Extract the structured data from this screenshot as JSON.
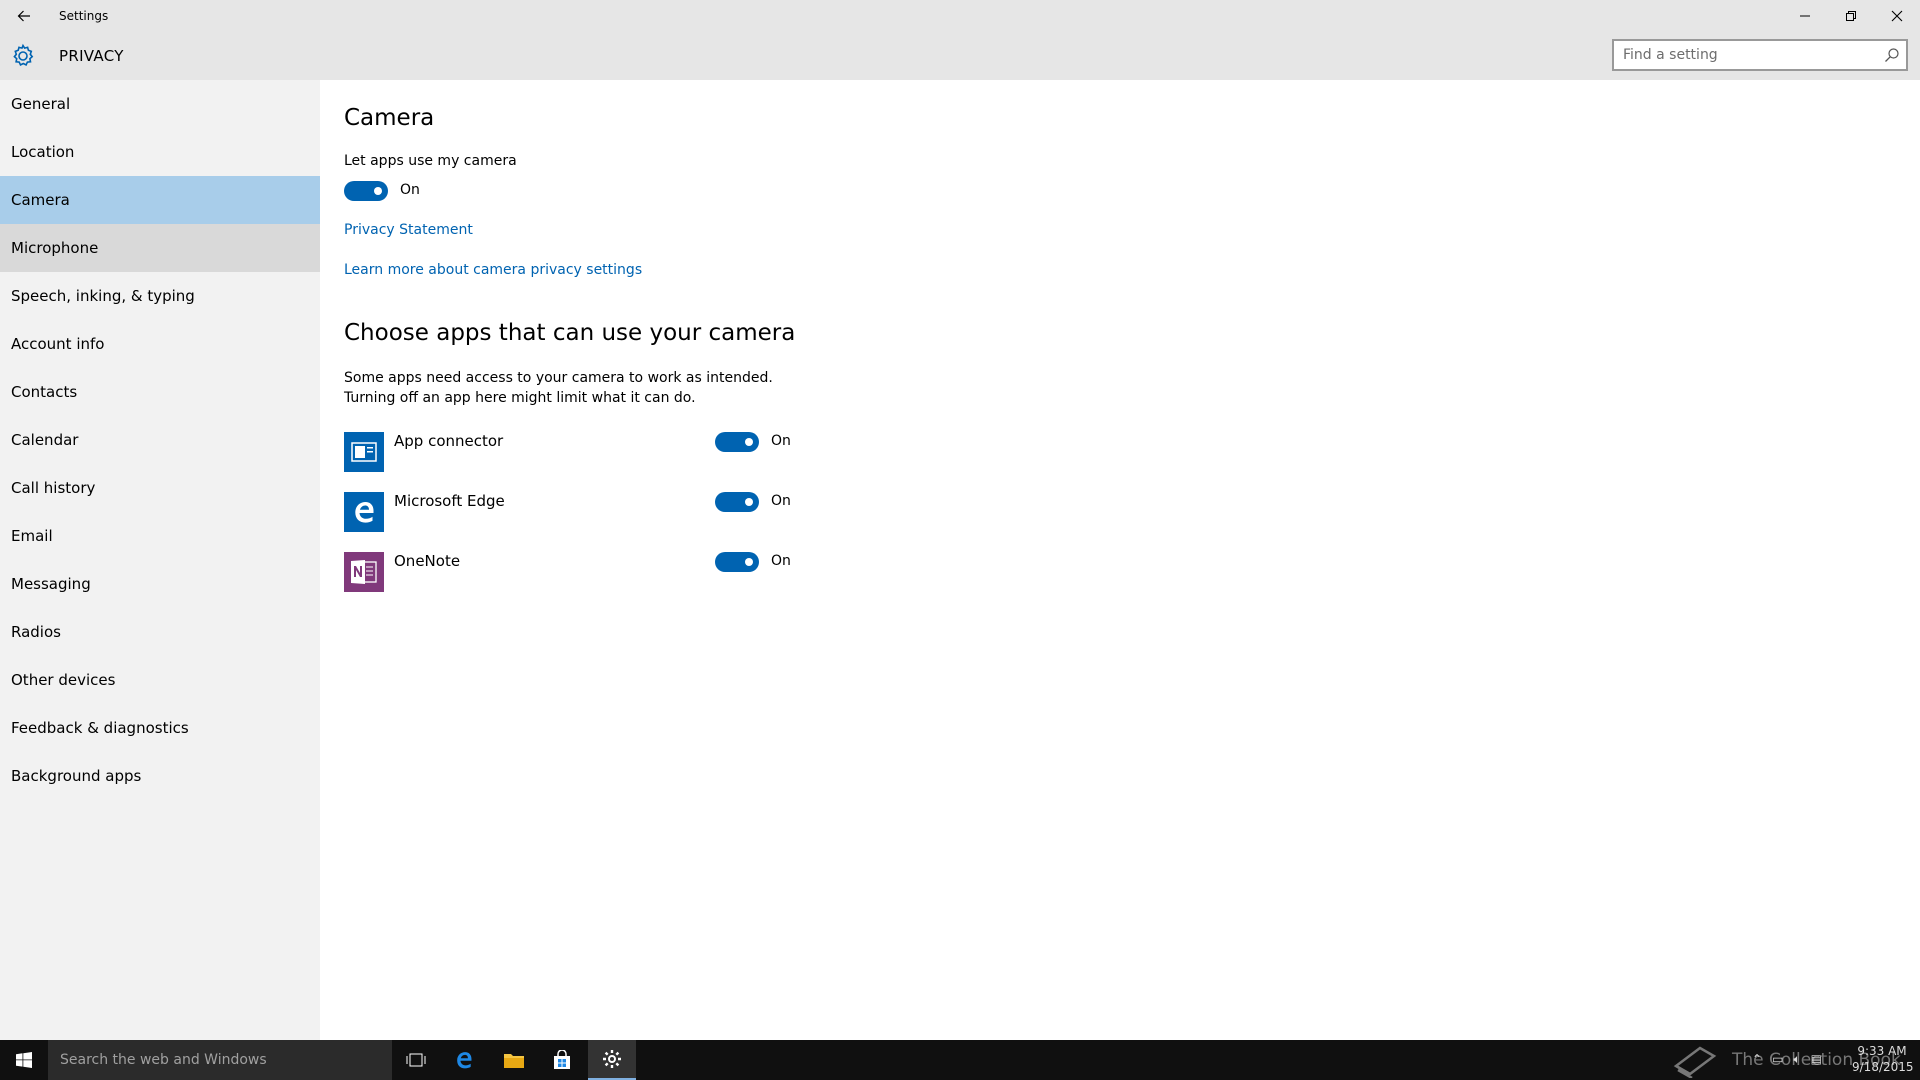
{
  "window": {
    "title": "Settings",
    "back_icon": "arrow-left-icon",
    "minimize_glyph": "—",
    "maximize_glyph": "❐",
    "close_glyph": "✕"
  },
  "header": {
    "title": "PRIVACY",
    "search_placeholder": "Find a setting",
    "search_value": ""
  },
  "sidebar": {
    "items": [
      {
        "label": "General"
      },
      {
        "label": "Location"
      },
      {
        "label": "Camera",
        "selected": true
      },
      {
        "label": "Microphone",
        "hovered": true
      },
      {
        "label": "Speech, inking, & typing"
      },
      {
        "label": "Account info"
      },
      {
        "label": "Contacts"
      },
      {
        "label": "Calendar"
      },
      {
        "label": "Call history"
      },
      {
        "label": "Email"
      },
      {
        "label": "Messaging"
      },
      {
        "label": "Radios"
      },
      {
        "label": "Other devices"
      },
      {
        "label": "Feedback & diagnostics"
      },
      {
        "label": "Background apps"
      }
    ]
  },
  "main": {
    "title": "Camera",
    "master_toggle_label": "Let apps use my camera",
    "master_toggle_state": "On",
    "privacy_link": "Privacy Statement",
    "learn_more_link": "Learn more about camera privacy settings",
    "section_title": "Choose apps that can use your camera",
    "description_line1": "Some apps need access to your camera to work as intended.",
    "description_line2": "Turning off an app here might limit what it can do.",
    "apps": [
      {
        "name": "App connector",
        "state": "On",
        "icon_color": "#0063b1"
      },
      {
        "name": "Microsoft Edge",
        "state": "On",
        "icon_color": "#0063b1"
      },
      {
        "name": "OneNote",
        "state": "On",
        "icon_color": "#80397b"
      }
    ]
  },
  "taskbar": {
    "search_placeholder": "Search the web and Windows",
    "watermark": "The Collection Book",
    "time": "9:33 AM",
    "date": "9/18/2015"
  },
  "colors": {
    "accent": "#0063b1",
    "selected_nav": "#a8cdea",
    "chrome": "#e6e6e6",
    "sidebar": "#f2f2f2",
    "taskbar": "#101010"
  }
}
